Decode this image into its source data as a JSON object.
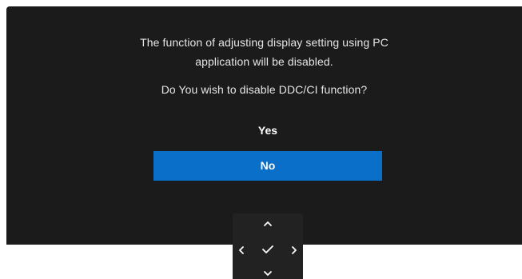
{
  "dialog": {
    "message_line1": "The function of adjusting display setting using PC",
    "message_line2": "application will be disabled.",
    "question": "Do You wish to disable DDC/CI function?"
  },
  "options": [
    {
      "label": "Yes",
      "selected": false
    },
    {
      "label": "No",
      "selected": true
    }
  ],
  "navigation": {
    "icons": [
      "chevron-up-icon",
      "chevron-left-icon",
      "checkmark-icon",
      "chevron-right-icon",
      "chevron-down-icon"
    ]
  },
  "colors": {
    "panel_background": "#1b1b1b",
    "text": "#e6e6e6",
    "selected_highlight": "#0a6fc9",
    "nav_pad_background": "#222222",
    "page_background": "#ffffff"
  }
}
